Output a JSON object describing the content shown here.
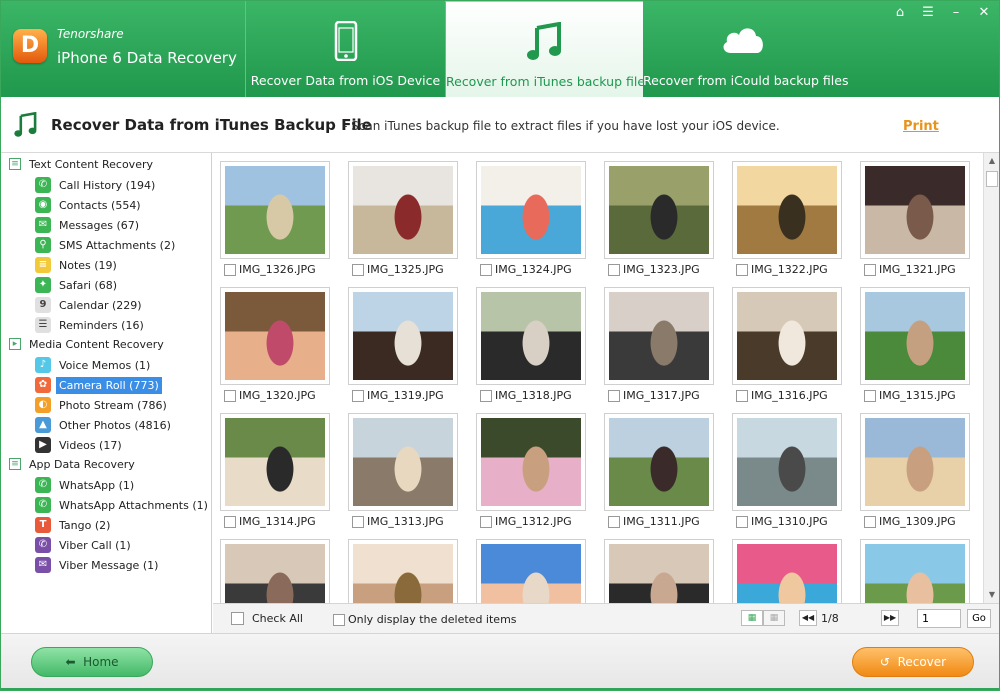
{
  "app": {
    "brand": "Tenorshare",
    "product": "iPhone 6 Data Recovery",
    "logo_letter": "D"
  },
  "window_controls": {
    "home": "⌂",
    "settings": "☰",
    "minimize": "–",
    "close": "✕"
  },
  "tabs": [
    {
      "label": "Recover Data from iOS Device",
      "icon": "phone-icon"
    },
    {
      "label": "Recover from iTunes backup files",
      "icon": "music-note-icon"
    },
    {
      "label": "Recover from iCould backup files",
      "icon": "cloud-icon"
    }
  ],
  "title": {
    "main": "Recover Data from iTunes Backup File",
    "desc": "- Scan iTunes backup file to extract files if you have lost your iOS device.",
    "print": "Print"
  },
  "sidebar": {
    "sections": [
      {
        "label": "Text Content Recovery",
        "items": [
          {
            "label": "Call History (194)",
            "color": "#3cb554",
            "glyph": "✆"
          },
          {
            "label": "Contacts (554)",
            "color": "#3cb554",
            "glyph": "◉"
          },
          {
            "label": "Messages (67)",
            "color": "#3cb554",
            "glyph": "✉"
          },
          {
            "label": "SMS Attachments (2)",
            "color": "#3cb554",
            "glyph": "⚲"
          },
          {
            "label": "Notes (19)",
            "color": "#f2c93a",
            "glyph": "≡"
          },
          {
            "label": "Safari (68)",
            "color": "#3cb554",
            "glyph": "✦"
          },
          {
            "label": "Calendar (229)",
            "color": "#e0e0e0",
            "glyph": "9"
          },
          {
            "label": "Reminders (16)",
            "color": "#e0e0e0",
            "glyph": "☰"
          }
        ]
      },
      {
        "label": "Media Content Recovery",
        "items": [
          {
            "label": "Voice Memos (1)",
            "color": "#55c8e8",
            "glyph": "♪"
          },
          {
            "label": "Camera Roll (773)",
            "color": "#f06a3c",
            "glyph": "✿"
          },
          {
            "label": "Photo Stream (786)",
            "color": "#f2a02a",
            "glyph": "◐"
          },
          {
            "label": "Other Photos (4816)",
            "color": "#4a9ad8",
            "glyph": "▲"
          },
          {
            "label": "Videos (17)",
            "color": "#333333",
            "glyph": "▶"
          }
        ]
      },
      {
        "label": "App Data Recovery",
        "items": [
          {
            "label": "WhatsApp (1)",
            "color": "#3cb554",
            "glyph": "✆"
          },
          {
            "label": "WhatsApp Attachments (1)",
            "color": "#3cb554",
            "glyph": "✆"
          },
          {
            "label": "Tango (2)",
            "color": "#e85a3a",
            "glyph": "T"
          },
          {
            "label": "Viber Call (1)",
            "color": "#7a4fa8",
            "glyph": "✆"
          },
          {
            "label": "Viber Message (1)",
            "color": "#7a4fa8",
            "glyph": "✉"
          }
        ]
      }
    ]
  },
  "photos": [
    {
      "name": "IMG_1326.JPG",
      "colors": [
        "#9fc2e0",
        "#6f9a50",
        "#d8c9a6"
      ]
    },
    {
      "name": "IMG_1325.JPG",
      "colors": [
        "#e8e4df",
        "#c7b89c",
        "#8a2a2a"
      ]
    },
    {
      "name": "IMG_1324.JPG",
      "colors": [
        "#f3efe9",
        "#4aa8d8",
        "#e86a5a"
      ]
    },
    {
      "name": "IMG_1323.JPG",
      "colors": [
        "#9aa06a",
        "#5a6a3a",
        "#2a2a2a"
      ]
    },
    {
      "name": "IMG_1322.JPG",
      "colors": [
        "#f3d7a0",
        "#a07a40",
        "#3a3020"
      ]
    },
    {
      "name": "IMG_1321.JPG",
      "colors": [
        "#3a2a2a",
        "#c9b8a6",
        "#7a5a4a"
      ]
    },
    {
      "name": "IMG_1320.JPG",
      "colors": [
        "#7a5a3a",
        "#e8b08a",
        "#c04a6a"
      ]
    },
    {
      "name": "IMG_1319.JPG",
      "colors": [
        "#bcd4e6",
        "#3a2a22",
        "#e6e0d6"
      ]
    },
    {
      "name": "IMG_1318.JPG",
      "colors": [
        "#b8c4a8",
        "#2a2a2a",
        "#d8d0c4"
      ]
    },
    {
      "name": "IMG_1317.JPG",
      "colors": [
        "#d8d0c8",
        "#3a3a3a",
        "#8a7a6a"
      ]
    },
    {
      "name": "IMG_1316.JPG",
      "colors": [
        "#d6c9b8",
        "#4a3a2a",
        "#f0e8dc"
      ]
    },
    {
      "name": "IMG_1315.JPG",
      "colors": [
        "#a8c8e0",
        "#4a8a3a",
        "#c4a080"
      ]
    },
    {
      "name": "IMG_1314.JPG",
      "colors": [
        "#6a8a4a",
        "#e8dcc8",
        "#2a2a2a"
      ]
    },
    {
      "name": "IMG_1313.JPG",
      "colors": [
        "#c8d4dc",
        "#8a7a6a",
        "#e8d8c0"
      ]
    },
    {
      "name": "IMG_1312.JPG",
      "colors": [
        "#3a4a2a",
        "#e8b0c8",
        "#c8a080"
      ]
    },
    {
      "name": "IMG_1311.JPG",
      "colors": [
        "#bcd0e0",
        "#6a8a4a",
        "#3a2a2a"
      ]
    },
    {
      "name": "IMG_1310.JPG",
      "colors": [
        "#c8d8e0",
        "#7a8a8a",
        "#4a4a4a"
      ]
    },
    {
      "name": "IMG_1309.JPG",
      "colors": [
        "#9ab8d8",
        "#e8d0a8",
        "#c8a080"
      ]
    },
    {
      "name": "",
      "colors": [
        "#d8c8b8",
        "#3a3a3a",
        "#8a6a5a"
      ]
    },
    {
      "name": "",
      "colors": [
        "#f0e0d0",
        "#c8a080",
        "#8a6a3a"
      ]
    },
    {
      "name": "",
      "colors": [
        "#4a8ad8",
        "#f0c0a0",
        "#e8d8c8"
      ]
    },
    {
      "name": "",
      "colors": [
        "#d8c8b8",
        "#2a2a2a",
        "#c8a890"
      ]
    },
    {
      "name": "",
      "colors": [
        "#e85a8a",
        "#3aa8d8",
        "#f0c8a0"
      ]
    },
    {
      "name": "",
      "colors": [
        "#8ac8e8",
        "#6a9a4a",
        "#e8c0a0"
      ]
    }
  ],
  "toolbar": {
    "check_all": "Check All",
    "only_deleted": "Only display the deleted items",
    "page_info": "1/8",
    "page_input": "1",
    "go": "Go"
  },
  "footer": {
    "home": "Home",
    "recover": "Recover"
  }
}
